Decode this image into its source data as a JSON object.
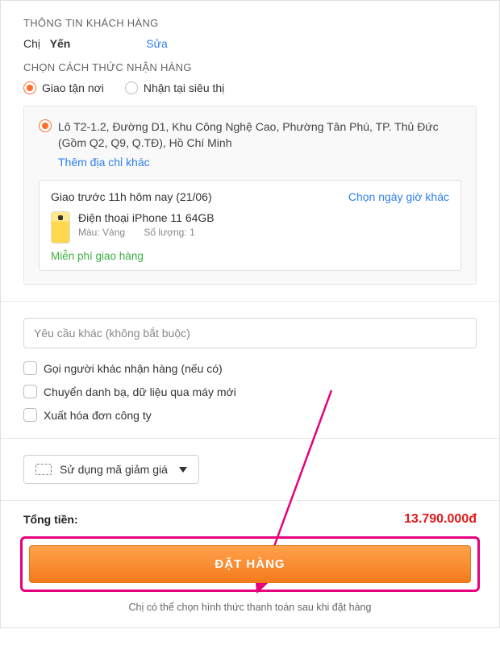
{
  "customer": {
    "section_title": "THÔNG TIN KHÁCH HÀNG",
    "prefix": "Chị",
    "name": "Yến",
    "edit_label": "Sửa"
  },
  "delivery": {
    "section_title": "CHỌN CÁCH THỨC NHẬN HÀNG",
    "options": {
      "home": "Giao tận nơi",
      "store": "Nhận tại siêu thị"
    },
    "address": "Lô T2-1.2, Đường D1, Khu Công Nghệ Cao, Phường Tân Phú, TP. Thủ Đức (Gồm Q2, Q9, Q.TĐ), Hồ Chí Minh",
    "add_address": "Thêm địa chỉ khác",
    "ship_when": "Giao trước 11h hôm nay (21/06)",
    "other_time": "Chọn ngày giờ khác",
    "product": {
      "name": "Điện thoại iPhone 11 64GB",
      "color_label": "Màu: Vàng",
      "qty_label": "Số lượng: 1"
    },
    "free_ship": "Miễn phí giao hàng"
  },
  "extras": {
    "note_placeholder": "Yêu cầu khác (không bắt buộc)",
    "checks": {
      "other_receiver": "Gọi người khác nhận hàng (nếu có)",
      "transfer_data": "Chuyển danh bạ, dữ liệu qua máy mới",
      "invoice": "Xuất hóa đơn công ty"
    }
  },
  "coupon": {
    "label": "Sử dụng mã giảm giá"
  },
  "summary": {
    "total_label": "Tổng tiền:",
    "total_value": "13.790.000đ",
    "cta": "ĐẶT HÀNG",
    "disclaimer": "Chị có thể chọn hình thức thanh toán sau khi đặt hàng"
  }
}
